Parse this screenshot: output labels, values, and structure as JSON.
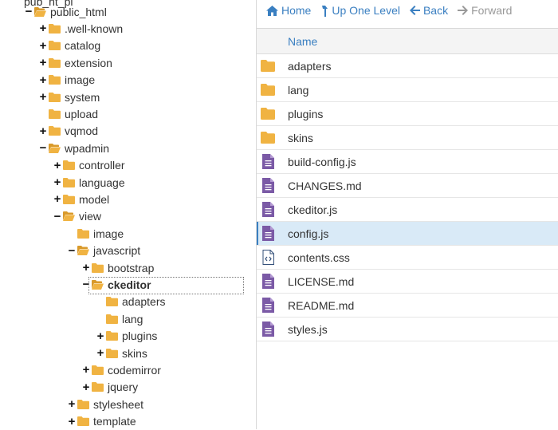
{
  "tree": {
    "partial_top": "pub_ht_pl",
    "items": [
      {
        "label": "public_html",
        "toggle": "−",
        "open": true,
        "level": 0,
        "selected": false
      },
      {
        "label": ".well-known",
        "toggle": "+",
        "open": false,
        "level": 1,
        "selected": false
      },
      {
        "label": "catalog",
        "toggle": "+",
        "open": false,
        "level": 1,
        "selected": false
      },
      {
        "label": "extension",
        "toggle": "+",
        "open": false,
        "level": 1,
        "selected": false
      },
      {
        "label": "image",
        "toggle": "+",
        "open": false,
        "level": 1,
        "selected": false
      },
      {
        "label": "system",
        "toggle": "+",
        "open": false,
        "level": 1,
        "selected": false
      },
      {
        "label": "upload",
        "toggle": "",
        "open": false,
        "level": 1,
        "selected": false
      },
      {
        "label": "vqmod",
        "toggle": "+",
        "open": false,
        "level": 1,
        "selected": false
      },
      {
        "label": "wpadmin",
        "toggle": "−",
        "open": true,
        "level": 1,
        "selected": false
      },
      {
        "label": "controller",
        "toggle": "+",
        "open": false,
        "level": 2,
        "selected": false
      },
      {
        "label": "language",
        "toggle": "+",
        "open": false,
        "level": 2,
        "selected": false
      },
      {
        "label": "model",
        "toggle": "+",
        "open": false,
        "level": 2,
        "selected": false
      },
      {
        "label": "view",
        "toggle": "−",
        "open": true,
        "level": 2,
        "selected": false
      },
      {
        "label": "image",
        "toggle": "",
        "open": false,
        "level": 3,
        "selected": false
      },
      {
        "label": "javascript",
        "toggle": "−",
        "open": true,
        "level": 3,
        "selected": false
      },
      {
        "label": "bootstrap",
        "toggle": "+",
        "open": false,
        "level": 4,
        "selected": false
      },
      {
        "label": "ckeditor",
        "toggle": "−",
        "open": true,
        "level": 4,
        "selected": true
      },
      {
        "label": "adapters",
        "toggle": "",
        "open": false,
        "level": 5,
        "selected": false
      },
      {
        "label": "lang",
        "toggle": "",
        "open": false,
        "level": 5,
        "selected": false
      },
      {
        "label": "plugins",
        "toggle": "+",
        "open": false,
        "level": 5,
        "selected": false
      },
      {
        "label": "skins",
        "toggle": "+",
        "open": false,
        "level": 5,
        "selected": false
      },
      {
        "label": "codemirror",
        "toggle": "+",
        "open": false,
        "level": 4,
        "selected": false
      },
      {
        "label": "jquery",
        "toggle": "+",
        "open": false,
        "level": 4,
        "selected": false
      },
      {
        "label": "stylesheet",
        "toggle": "+",
        "open": false,
        "level": 3,
        "selected": false
      },
      {
        "label": "template",
        "toggle": "+",
        "open": false,
        "level": 3,
        "selected": false
      }
    ]
  },
  "toolbar": {
    "home_label": "Home",
    "up_label": "Up One Level",
    "back_label": "Back",
    "forward_label": "Forward"
  },
  "file_list": {
    "column_name": "Name",
    "rows": [
      {
        "name": "adapters",
        "type": "folder",
        "selected": false
      },
      {
        "name": "lang",
        "type": "folder",
        "selected": false
      },
      {
        "name": "plugins",
        "type": "folder",
        "selected": false
      },
      {
        "name": "skins",
        "type": "folder",
        "selected": false
      },
      {
        "name": "build-config.js",
        "type": "text-file",
        "selected": false
      },
      {
        "name": "CHANGES.md",
        "type": "text-file",
        "selected": false
      },
      {
        "name": "ckeditor.js",
        "type": "text-file",
        "selected": false
      },
      {
        "name": "config.js",
        "type": "text-file",
        "selected": true
      },
      {
        "name": "contents.css",
        "type": "code-file",
        "selected": false
      },
      {
        "name": "LICENSE.md",
        "type": "text-file",
        "selected": false
      },
      {
        "name": "README.md",
        "type": "text-file",
        "selected": false
      },
      {
        "name": "styles.js",
        "type": "text-file",
        "selected": false
      }
    ]
  },
  "colors": {
    "accent": "#3a7fc1",
    "folder": "#f0b342",
    "file": "#7b5aa6",
    "selected_row": "#d9eaf7"
  }
}
